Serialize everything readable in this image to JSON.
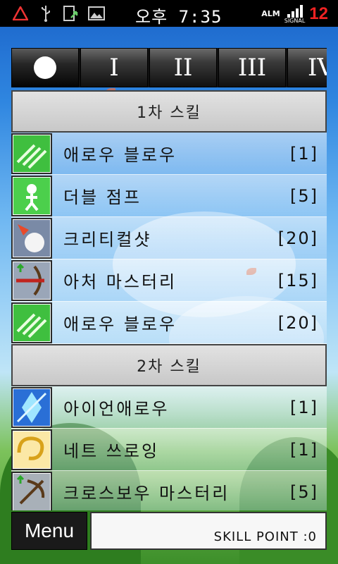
{
  "status": {
    "time": "오후 7:35",
    "alarm": "ALM",
    "signal_label": "SIGNAL",
    "battery": "12",
    "icons": [
      "warning-icon",
      "usb-icon",
      "sync-icon",
      "image-icon"
    ]
  },
  "tabs": [
    {
      "label": "●",
      "icon": "circle-dot-icon"
    },
    {
      "label": "I"
    },
    {
      "label": "II"
    },
    {
      "label": "III"
    },
    {
      "label": "IV"
    }
  ],
  "sections": [
    {
      "title": "1차 스킬",
      "skills": [
        {
          "name": "애로우 블로우",
          "level": "[1]",
          "icon": "arrow-blow-icon"
        },
        {
          "name": "더블 점프",
          "level": "[5]",
          "icon": "double-jump-icon"
        },
        {
          "name": "크리티컬샷",
          "level": "[20]",
          "icon": "critical-shot-icon"
        },
        {
          "name": "아처 마스터리",
          "level": "[15]",
          "icon": "archer-mastery-icon"
        },
        {
          "name": "애로우 블로우",
          "level": "[20]",
          "icon": "arrow-blow-icon"
        }
      ]
    },
    {
      "title": "2차 스킬",
      "skills": [
        {
          "name": "아이언애로우",
          "level": "[1]",
          "icon": "iron-arrow-icon"
        },
        {
          "name": "네트 쓰로잉",
          "level": "[1]",
          "icon": "net-throwing-icon"
        },
        {
          "name": "크로스보우 마스터리",
          "level": "[5]",
          "icon": "crossbow-mastery-icon"
        }
      ]
    }
  ],
  "bottom": {
    "menu_label": "Menu",
    "skill_point": "SKILL POINT :0"
  },
  "colors": {
    "status_bg": "#000000",
    "battery": "#e22222",
    "header_bg": "#d0d0d0"
  }
}
